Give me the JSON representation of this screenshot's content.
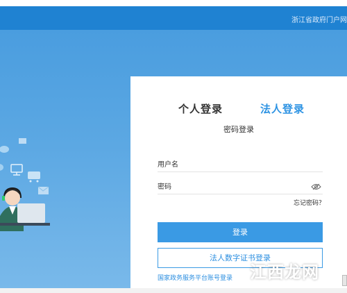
{
  "header": {
    "portal_link": "浙江省政府门户网"
  },
  "login": {
    "tab_personal": "个人登录",
    "tab_legal": "法人登录",
    "subtitle": "密码登录",
    "username_placeholder": "用户名",
    "password_placeholder": "密码",
    "forgot_password": "忘记密码？",
    "login_button": "登录",
    "cert_login_button": "法人数字证书登录",
    "national_account_link": "国家政务服务平台账号登录"
  },
  "watermark": {
    "text": "江西龙网"
  },
  "colors": {
    "header": "#1f82d2",
    "accent": "#3a9ae4",
    "tab_active": "#2d93e3",
    "hero_top": "#4a9ddf",
    "hero_bottom": "#79b9ea"
  },
  "icons": [
    "eye-icon",
    "headset-agent-icon",
    "monitor-icon",
    "cart-icon",
    "mail-icon",
    "chat-bubble-icon"
  ]
}
